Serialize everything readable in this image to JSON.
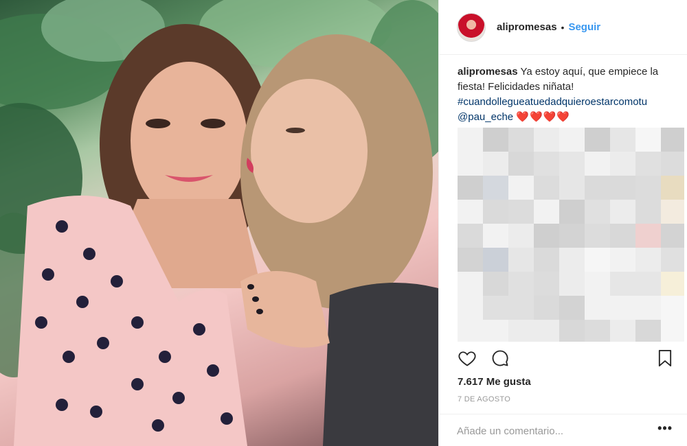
{
  "post": {
    "username": "alipromesas",
    "separator": "•",
    "follow_label": "Seguir",
    "caption": {
      "username": "alipromesas",
      "text": "Ya estoy aquí, que empiece la fiesta! Felicidades niñata!",
      "hashtag": "#cuandolleguеatuedadquieroestarcomotu",
      "mention": "@pau_eche",
      "hearts": "❤️❤️❤️❤️"
    },
    "likes": "7.617 Me gusta",
    "date": "7 DE AGOSTO",
    "comment_placeholder": "Añade un comentario...",
    "more_label": "•••"
  },
  "icons": {
    "like": "heart-icon",
    "comment": "comment-icon",
    "save": "bookmark-icon",
    "more": "more-options-icon"
  },
  "colors": {
    "link_blue": "#3897f0",
    "hashtag": "#003569",
    "text": "#262626",
    "muted": "#999999",
    "heart_red": "#e0102a"
  }
}
